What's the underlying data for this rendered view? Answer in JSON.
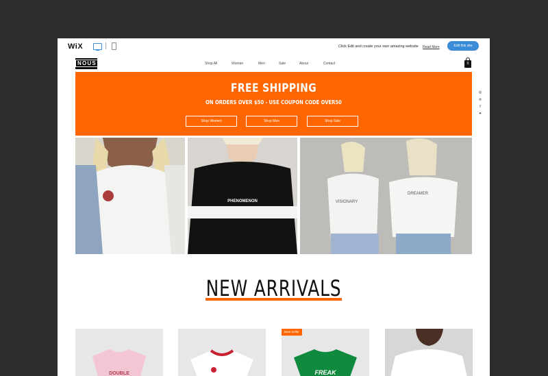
{
  "wixbar": {
    "logo": "WiX",
    "message": "Click Edit and create your own amazing website",
    "read_more": "Read More",
    "edit_button": "Edit this site"
  },
  "site": {
    "logo": "NOUS",
    "nav": [
      "Shop All",
      "Women",
      "Men",
      "Sale",
      "About",
      "Contact"
    ],
    "cart_count": "0"
  },
  "banner": {
    "title": "FREE SHIPPING",
    "subtitle": "ON ORDERS OVER $50 - USE COUPON CODE OVER50",
    "buttons": [
      "Shop Women",
      "Shop Men",
      "Shop Sale"
    ],
    "color": "#ff6600"
  },
  "social": [
    "instagram-icon",
    "pinterest-icon",
    "facebook-icon",
    "twitter-icon"
  ],
  "photos": {
    "shirt2_text": "PHENOMENON",
    "shirt3a_text": "VISIONARY",
    "shirt3b_text": "DREAMER"
  },
  "arrivals": {
    "title": "NEW ARRIVALS",
    "badge": "Best Seller",
    "prod1_text": "DOUBLE",
    "prod3_text": "FREAK"
  }
}
